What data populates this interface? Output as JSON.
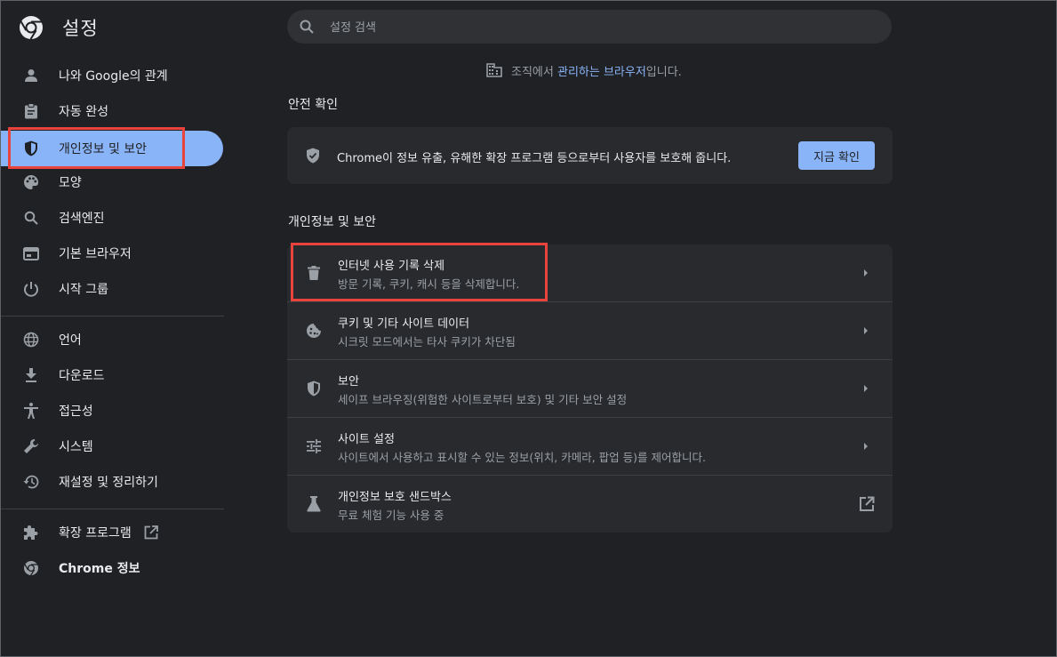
{
  "header": {
    "title": "설정",
    "search_placeholder": "설정 검색"
  },
  "sidebar": {
    "items": [
      {
        "label": "나와 Google의 관계",
        "icon": "person-icon"
      },
      {
        "label": "자동 완성",
        "icon": "clipboard-icon"
      },
      {
        "label": "개인정보 및 보안",
        "icon": "shield-icon",
        "active": true
      },
      {
        "label": "모양",
        "icon": "palette-icon"
      },
      {
        "label": "검색엔진",
        "icon": "search-icon"
      },
      {
        "label": "기본 브라우저",
        "icon": "browser-window-icon"
      },
      {
        "label": "시작 그룹",
        "icon": "power-icon"
      },
      {
        "label": "언어",
        "icon": "globe-icon"
      },
      {
        "label": "다운로드",
        "icon": "download-icon"
      },
      {
        "label": "접근성",
        "icon": "accessibility-icon"
      },
      {
        "label": "시스템",
        "icon": "wrench-icon"
      },
      {
        "label": "재설정 및 정리하기",
        "icon": "restore-icon"
      },
      {
        "label": "확장 프로그램",
        "icon": "puzzle-icon"
      },
      {
        "label": "Chrome 정보",
        "icon": "chrome-icon"
      }
    ]
  },
  "main": {
    "managed_prefix": "조직에서 ",
    "managed_link": "관리하는 브라우저",
    "managed_suffix": "입니다.",
    "safety_check": {
      "heading": "안전 확인",
      "text": "Chrome이 정보 유출, 유해한 확장 프로그램 등으로부터 사용자를 보호해 줍니다.",
      "button": "지금 확인"
    },
    "privacy": {
      "heading": "개인정보 및 보안",
      "rows": [
        {
          "title": "인터넷 사용 기록 삭제",
          "subtitle": "방문 기록, 쿠키, 캐시 등을 삭제합니다.",
          "icon": "trash-icon"
        },
        {
          "title": "쿠키 및 기타 사이트 데이터",
          "subtitle": "시크릿 모드에서는 타사 쿠키가 차단됨",
          "icon": "cookie-icon"
        },
        {
          "title": "보안",
          "subtitle": "세이프 브라우징(위험한 사이트로부터 보호) 및 기타 보안 설정",
          "icon": "shield-icon"
        },
        {
          "title": "사이트 설정",
          "subtitle": "사이트에서 사용하고 표시할 수 있는 정보(위치, 카메라, 팝업 등)를 제어합니다.",
          "icon": "tune-icon"
        },
        {
          "title": "개인정보 보호 샌드박스",
          "subtitle": "무료 체험 기능 사용 중",
          "icon": "flask-icon"
        }
      ]
    }
  },
  "colors": {
    "background": "#202124",
    "card": "#292a2d",
    "accent": "#8ab4f8",
    "highlight_box": "#e8443d",
    "secondary_text": "#9aa0a6"
  }
}
